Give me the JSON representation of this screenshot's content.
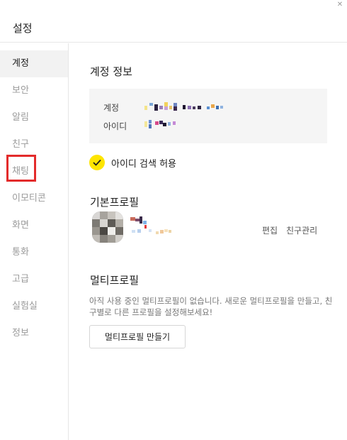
{
  "window": {
    "title": "설정",
    "close_icon": "close-icon"
  },
  "sidebar": {
    "items": [
      {
        "label": "계정",
        "active": true
      },
      {
        "label": "보안",
        "active": false
      },
      {
        "label": "알림",
        "active": false
      },
      {
        "label": "친구",
        "active": false
      },
      {
        "label": "채팅",
        "active": false
      },
      {
        "label": "이모티콘",
        "active": false
      },
      {
        "label": "화면",
        "active": false
      },
      {
        "label": "통화",
        "active": false
      },
      {
        "label": "고급",
        "active": false
      },
      {
        "label": "실험실",
        "active": false
      },
      {
        "label": "정보",
        "active": false
      }
    ],
    "highlight_color": "#e32b2b"
  },
  "account_info": {
    "title": "계정 정보",
    "account_label": "계정",
    "id_label": "아이디"
  },
  "id_search": {
    "label": "아이디 검색 허용",
    "checked": true,
    "check_color": "#fee500"
  },
  "basic_profile": {
    "title": "기본프로필",
    "edit_label": "편집",
    "manage_friends_label": "친구관리"
  },
  "multi_profile": {
    "title": "멀티프로필",
    "description": "아직 사용 중인 멀티프로필이 없습니다. 새로운 멀티프로필을 만들고, 친구별로 다른 프로필을 설정해보세요!",
    "create_button": "멀티프로필 만들기"
  }
}
